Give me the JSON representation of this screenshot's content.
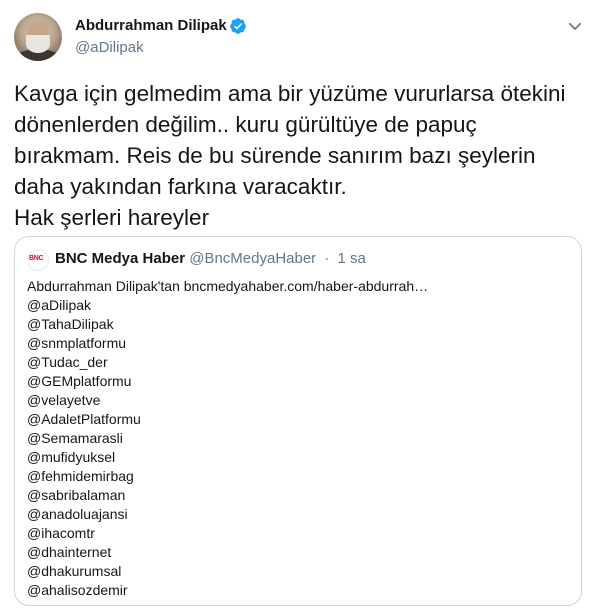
{
  "author": {
    "name": "Abdurrahman Dilipak",
    "handle": "@aDilipak",
    "verified_icon": "verified-badge-icon",
    "avatar_icon": "profile-photo"
  },
  "menu_icon": "chevron-down-icon",
  "tweet": {
    "lines": [
      "Kavga için gelmedim ama bir yüzüme vururlarsa ötekini",
      "dönenlerden değilim.. kuru gürültüye de papuç",
      "bırakmam. Reis de bu sürende sanırım bazı şeylerin",
      "daha yakından farkına varacaktır.",
      "Hak şerleri hareyler"
    ]
  },
  "quoted": {
    "logo_text": "BNC",
    "name": "BNC Medya Haber",
    "handle": "@BncMedyaHaber",
    "separator": "·",
    "time": "1 sa",
    "lines": [
      "Abdurrahman Dilipak'tan bncmedyahaber.com/haber-abdurrah…",
      "@aDilipak",
      "@TahaDilipak",
      "@snmplatformu",
      "@Tudac_der",
      "@GEMplatformu",
      "@velayetve",
      "@AdaletPlatformu",
      "@Semamarasli",
      "@mufidyuksel",
      "@fehmidemirbag",
      "@sabribalaman",
      "@anadoluajansi",
      "@ihacomtr",
      "@dhainternet",
      "@dhakurumsal",
      "@ahalisozdemir"
    ]
  },
  "colors": {
    "text": "#14171a",
    "muted": "#657786",
    "verified": "#1da1f2",
    "border": "#ccd6dd",
    "bnc_red": "#c8102e"
  }
}
